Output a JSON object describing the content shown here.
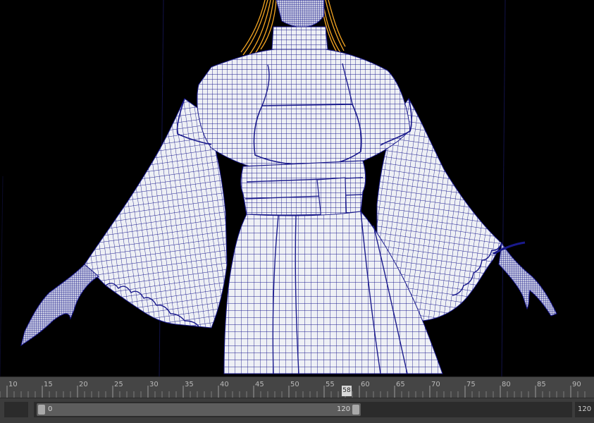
{
  "timeline": {
    "ticks": [
      "10",
      "15",
      "20",
      "25",
      "30",
      "35",
      "40",
      "45",
      "50",
      "55",
      "60",
      "65",
      "70",
      "75",
      "80",
      "85",
      "90"
    ],
    "current_frame": "58"
  },
  "range": {
    "start_field": "",
    "inner_start": "0",
    "inner_end": "120",
    "end_field": "120"
  },
  "colors": {
    "wire": "#1a1a8c",
    "mesh_fill": "#f2f2f6",
    "hair": "#f5a623",
    "panel": "#454545",
    "background": "#000000"
  },
  "icons": {
    "character": "wireframe-character-mesh"
  }
}
